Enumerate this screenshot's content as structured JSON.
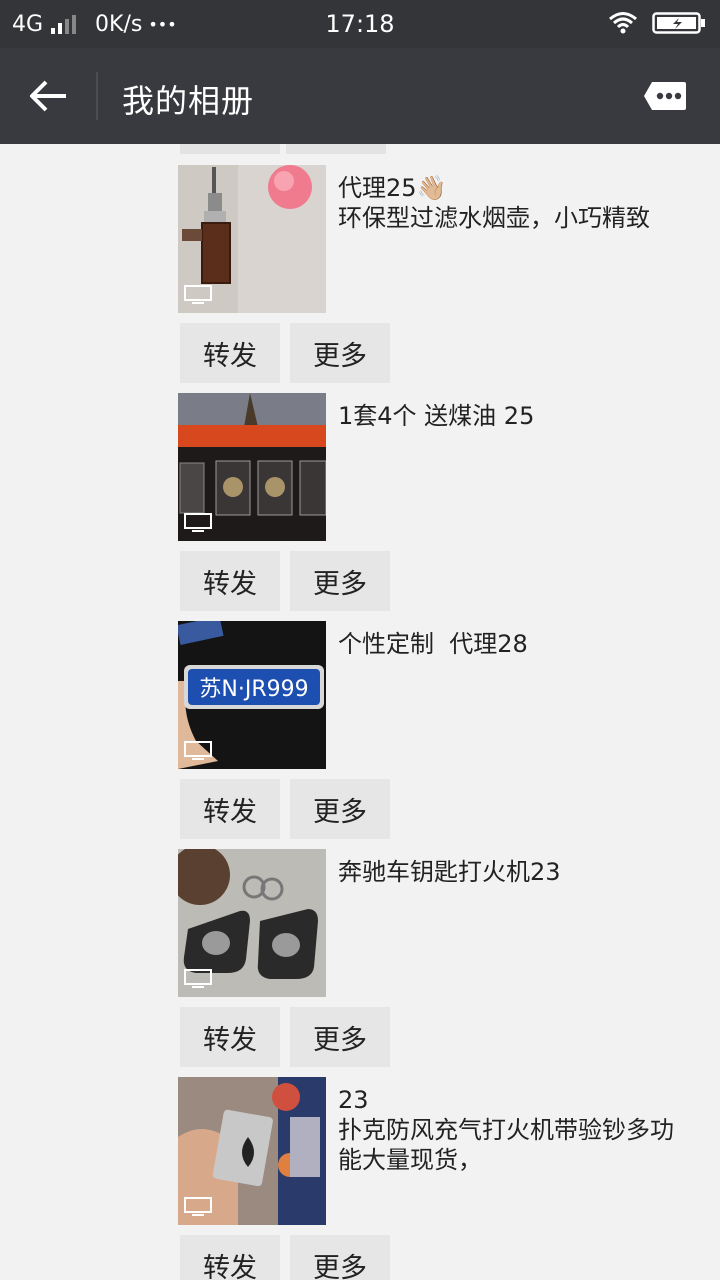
{
  "status": {
    "network": "4G",
    "speed": "0K/s",
    "dots": "•••",
    "time": "17:18"
  },
  "nav": {
    "title": "我的相册"
  },
  "posts": [
    {
      "line1": "代理25👋🏼",
      "line2": "环保型过滤水烟壶，小巧精致",
      "forward": "转发",
      "more": "更多",
      "thumb_icon": "photo-thumbnail-hookah"
    },
    {
      "line1": "1套4个 送煤油 25",
      "forward": "转发",
      "more": "更多",
      "thumb_icon": "photo-thumbnail-lighter-set"
    },
    {
      "line1": "个性定制  代理28",
      "plate": "苏N·JR999",
      "forward": "转发",
      "more": "更多",
      "thumb_icon": "photo-thumbnail-license-plate"
    },
    {
      "line1": "奔驰车钥匙打火机23",
      "forward": "转发",
      "more": "更多",
      "thumb_icon": "photo-thumbnail-car-keys"
    },
    {
      "line1": "23",
      "line2": "扑克防风充气打火机带验钞多功能大量现货，",
      "forward": "转发",
      "more": "更多",
      "thumb_icon": "photo-thumbnail-poker-lighter"
    }
  ],
  "colors": {
    "navbar": "#393a3f",
    "statusbar": "#333538",
    "background": "#f2f2f2",
    "button": "#e6e6e6"
  }
}
